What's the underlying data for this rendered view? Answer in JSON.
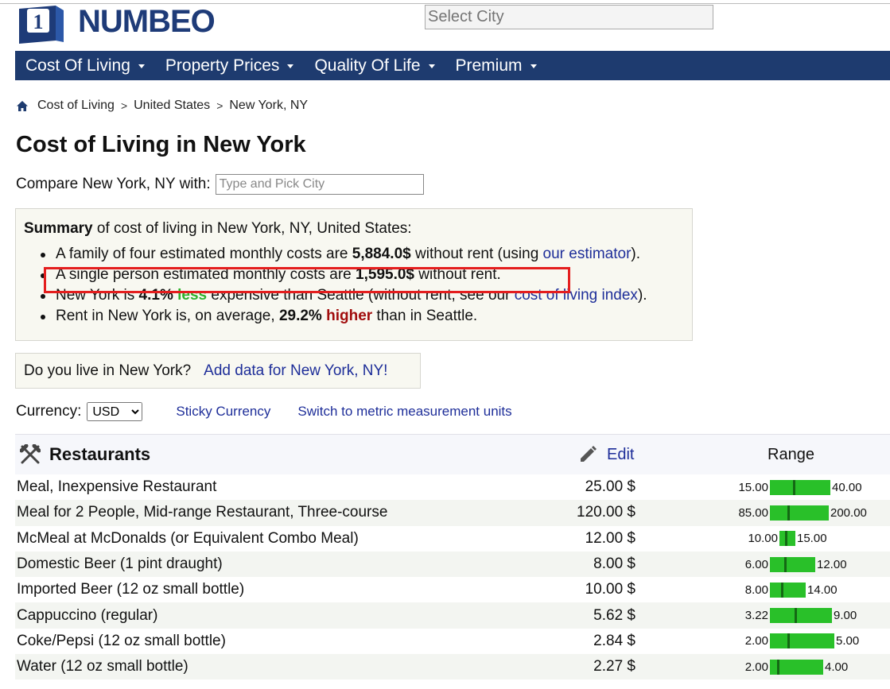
{
  "header": {
    "logo_text": "NUMBEO",
    "select_city_placeholder": "Select City"
  },
  "nav": [
    {
      "label": "Cost Of Living"
    },
    {
      "label": "Property Prices"
    },
    {
      "label": "Quality Of Life"
    },
    {
      "label": "Premium"
    }
  ],
  "breadcrumb": [
    "Cost of Living",
    "United States",
    "New York, NY"
  ],
  "page_title": "Cost of Living in New York",
  "compare": {
    "label": "Compare New York, NY with:",
    "placeholder": "Type and Pick City"
  },
  "summary": {
    "lead_bold": "Summary",
    "lead_rest": " of cost of living in New York, NY, United States:",
    "family": {
      "pre": "A family of four estimated monthly costs are ",
      "value": "5,884.0$",
      "post": " without rent (using ",
      "link": "our estimator",
      "end": ")."
    },
    "single": {
      "pre": "A single person estimated monthly costs are ",
      "value": "1,595.0$",
      "post": " without rent."
    },
    "compare_line": {
      "pre": "New York is ",
      "pct": "4.1%",
      "word": "less",
      "post": " expensive than Seattle (without rent, see our ",
      "link": "cost of living index",
      "end": ")."
    },
    "rent_line": {
      "pre": "Rent in New York is, on average, ",
      "pct": "29.2%",
      "word": "higher",
      "post": " than in Seattle."
    }
  },
  "live": {
    "question": "Do you live in New York?",
    "link": "Add data for New York, NY!"
  },
  "currency": {
    "label": "Currency:",
    "selected": "USD",
    "sticky": "Sticky Currency",
    "metric": "Switch to metric measurement units"
  },
  "restaurants": {
    "title": "Restaurants",
    "edit": "Edit",
    "range": "Range",
    "rows": [
      {
        "name": "Meal, Inexpensive Restaurant",
        "price": "25.00 $",
        "min": "15.00",
        "max": "40.00",
        "minv": 15,
        "maxv": 40,
        "val": 25
      },
      {
        "name": "Meal for 2 People, Mid-range Restaurant, Three-course",
        "price": "120.00 $",
        "min": "85.00",
        "max": "200.00",
        "minv": 85,
        "maxv": 200,
        "val": 120
      },
      {
        "name": "McMeal at McDonalds (or Equivalent Combo Meal)",
        "price": "12.00 $",
        "min": "10.00",
        "max": "15.00",
        "minv": 10,
        "maxv": 15,
        "val": 12
      },
      {
        "name": "Domestic Beer (1 pint draught)",
        "price": "8.00 $",
        "min": "6.00",
        "max": "12.00",
        "minv": 6,
        "maxv": 12,
        "val": 8
      },
      {
        "name": "Imported Beer (12 oz small bottle)",
        "price": "10.00 $",
        "min": "8.00",
        "max": "14.00",
        "minv": 8,
        "maxv": 14,
        "val": 10
      },
      {
        "name": "Cappuccino (regular)",
        "price": "5.62 $",
        "min": "3.22",
        "max": "9.00",
        "minv": 3.22,
        "maxv": 9,
        "val": 5.62
      },
      {
        "name": "Coke/Pepsi (12 oz small bottle)",
        "price": "2.84 $",
        "min": "2.00",
        "max": "5.00",
        "minv": 2,
        "maxv": 5,
        "val": 2.84
      },
      {
        "name": "Water (12 oz small bottle)",
        "price": "2.27 $",
        "min": "2.00",
        "max": "4.00",
        "minv": 2,
        "maxv": 4,
        "val": 2.27
      }
    ]
  },
  "colors": {
    "nav_bg": "#1e3b6f",
    "link": "#1e2e99",
    "bar": "#29c029",
    "highlight": "#e41e1e"
  }
}
